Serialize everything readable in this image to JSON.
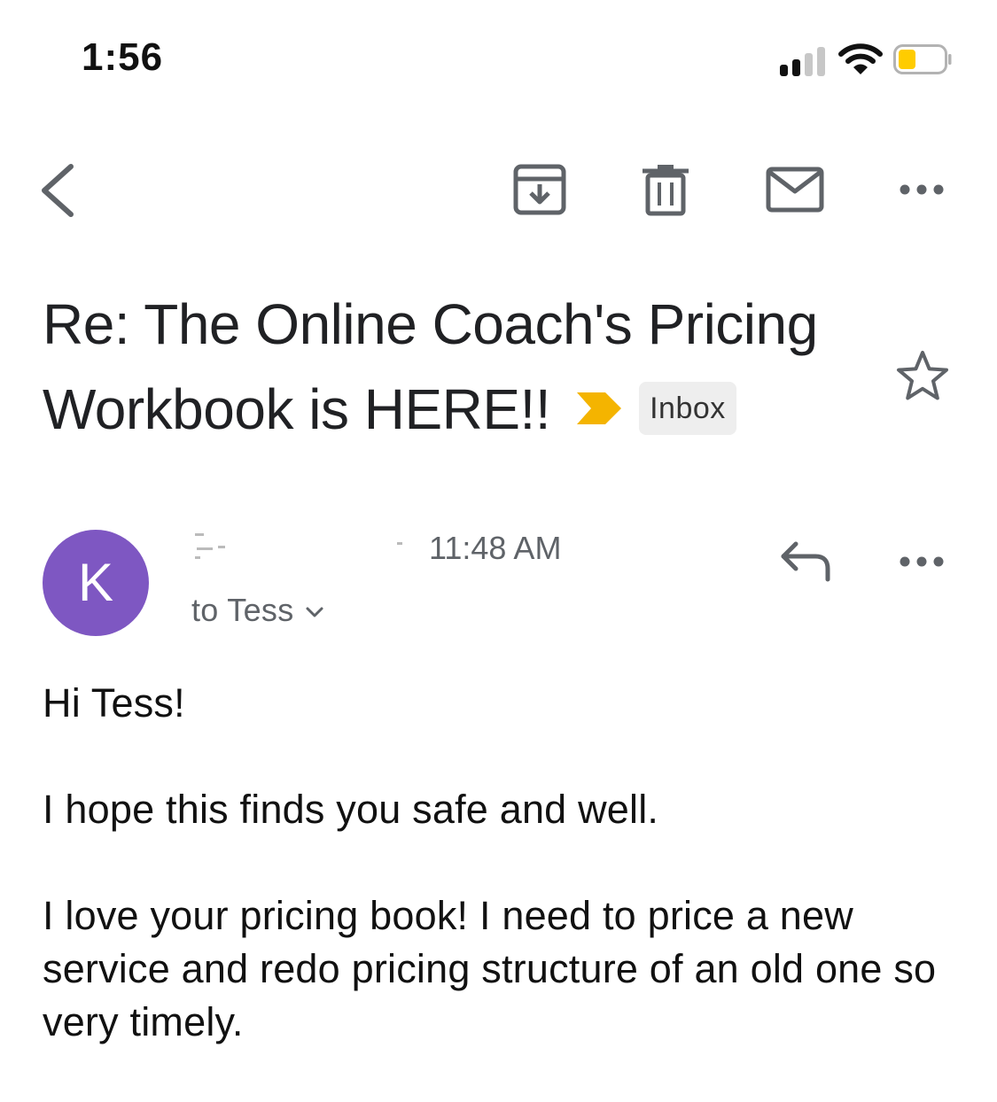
{
  "status_bar": {
    "time": "1:56",
    "signal_bars_active": 2,
    "signal_bars_total": 4,
    "battery_level": 0.35,
    "battery_color": "#ffcc00"
  },
  "toolbar": {
    "back_icon": "chevron-left-icon",
    "archive_icon": "archive-icon",
    "delete_icon": "trash-icon",
    "mark_unread_icon": "mail-icon",
    "more_icon": "more-horizontal-icon"
  },
  "email": {
    "subject": "Re: The Online Coach's Pricing Workbook is HERE!!",
    "importance_color": "#f4b400",
    "label": "Inbox",
    "starred": false,
    "sender_initial": "K",
    "avatar_color": "#7e57c2",
    "time": "11:48 AM",
    "recipient": "to Tess",
    "body": [
      "Hi Tess!",
      "I hope this finds you safe and well.",
      "I love your pricing book! I need to price a new service and redo pricing structure of an old one so very timely."
    ]
  },
  "colors": {
    "icon_gray": "#5f6368",
    "text_primary": "#202124"
  }
}
